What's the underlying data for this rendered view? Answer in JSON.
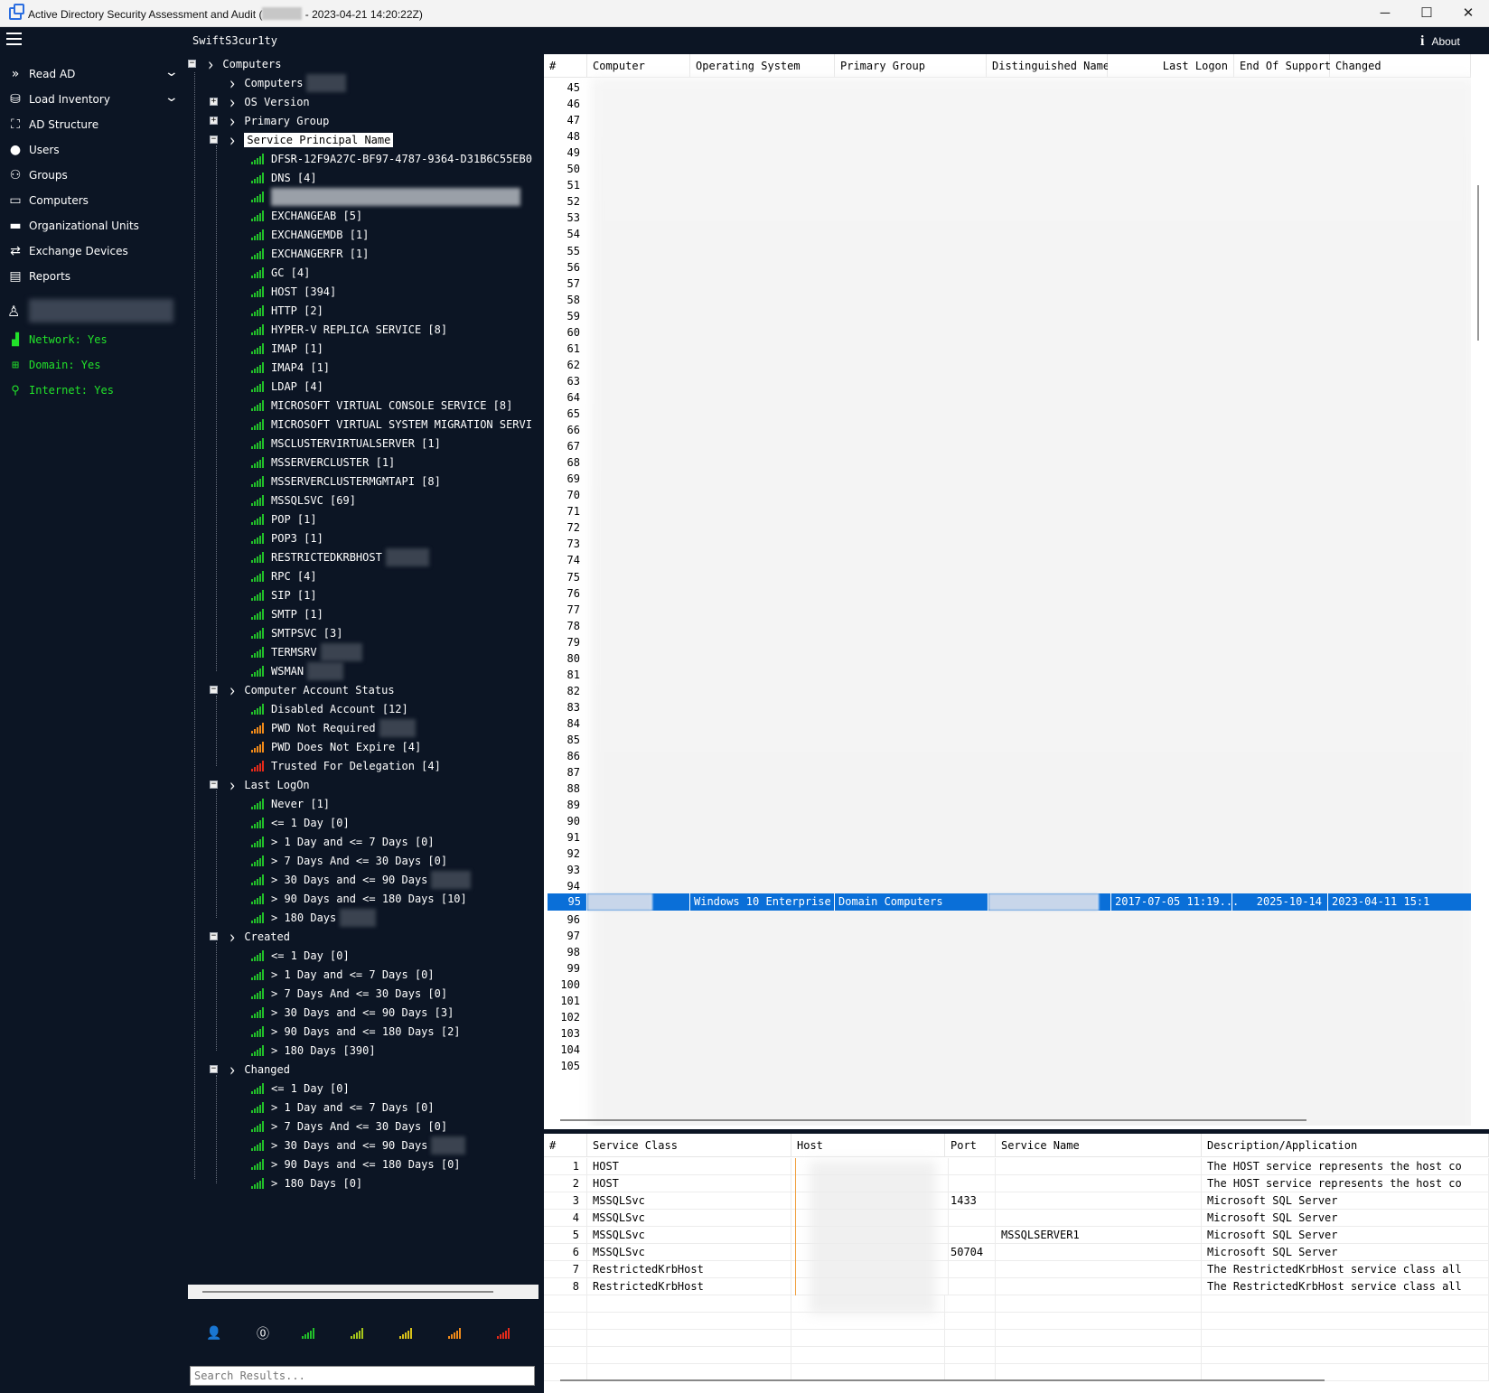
{
  "window": {
    "title_prefix": "Active Directory Security Assessment and Audit (",
    "title_suffix": " - 2023-04-21 14:20:22Z)",
    "minimize": "─",
    "maximize": "☐",
    "close": "✕"
  },
  "topbar": {
    "brand": "SwiftS3cur1ty",
    "about": "About"
  },
  "sidebar": {
    "items": [
      {
        "label": "Read AD",
        "icon": "chevrons-right-icon"
      },
      {
        "label": "Load Inventory",
        "icon": "database-icon"
      },
      {
        "label": "AD Structure",
        "icon": "hierarchy-icon"
      },
      {
        "label": "Users",
        "icon": "user-icon"
      },
      {
        "label": "Groups",
        "icon": "group-icon"
      },
      {
        "label": "Computers",
        "icon": "monitor-icon"
      },
      {
        "label": "Organizational Units",
        "icon": "folder-icon"
      },
      {
        "label": "Exchange Devices",
        "icon": "exchange-icon"
      },
      {
        "label": "Reports",
        "icon": "clipboard-icon"
      }
    ],
    "status": [
      {
        "label": "Network: Yes"
      },
      {
        "label": "Domain: Yes"
      },
      {
        "label": "Internet: Yes"
      }
    ]
  },
  "tree": {
    "root": "Computers",
    "sub_computers": "Computers",
    "os_version": "OS Version",
    "primary_group": "Primary Group",
    "spn": "Service Principal Name",
    "spn_items": [
      "DFSR-12F9A27C-BF97-4787-9364-D31B6C55EB0",
      "DNS [4]",
      "",
      "EXCHANGEAB [5]",
      "EXCHANGEMDB [1]",
      "EXCHANGERFR [1]",
      "GC [4]",
      "HOST [394]",
      "HTTP [2]",
      "HYPER-V REPLICA SERVICE [8]",
      "IMAP [1]",
      "IMAP4 [1]",
      "LDAP [4]",
      "MICROSOFT VIRTUAL CONSOLE SERVICE [8]",
      "MICROSOFT VIRTUAL SYSTEM MIGRATION SERVI",
      "MSCLUSTERVIRTUALSERVER [1]",
      "MSSERVERCLUSTER [1]",
      "MSSERVERCLUSTERMGMTAPI [8]",
      "MSSQLSVC [69]",
      "POP [1]",
      "POP3 [1]",
      "RESTRICTEDKRBHOST",
      "RPC [4]",
      "SIP [1]",
      "SMTP [1]",
      "SMTPSVC [3]",
      "TERMSRV",
      "WSMAN"
    ],
    "account_status": "Computer Account Status",
    "account_items": [
      {
        "label": "Disabled Account [12]",
        "level": "green"
      },
      {
        "label": "PWD Not Required",
        "level": "orange"
      },
      {
        "label": "PWD Does Not Expire [4]",
        "level": "orange"
      },
      {
        "label": "Trusted For Delegation [4]",
        "level": "red"
      }
    ],
    "last_logon": "Last LogOn",
    "last_logon_items": [
      "Never [1]",
      "<= 1 Day [0]",
      "> 1 Day and <= 7 Days [0]",
      "> 7 Days And <= 30 Days [0]",
      "> 30 Days and <= 90 Days",
      "> 90 Days and <= 180 Days [10]",
      "> 180 Days"
    ],
    "created": "Created",
    "created_items": [
      "<= 1 Day [0]",
      "> 1 Day and <= 7 Days [0]",
      "> 7 Days And <= 30 Days [0]",
      "> 30 Days and <= 90 Days [3]",
      "> 90 Days and <= 180 Days [2]",
      "> 180 Days [390]"
    ],
    "changed": "Changed",
    "changed_items": [
      "<= 1 Day [0]",
      "> 1 Day and <= 7 Days [0]",
      "> 7 Days And <= 30 Days [0]",
      "> 30 Days and <= 90 Days",
      "> 90 Days and <= 180 Days [0]",
      "> 180 Days [0]"
    ]
  },
  "search": {
    "placeholder": "Search Results..."
  },
  "main_grid": {
    "columns": [
      "#",
      "Computer",
      "Operating System",
      "Primary Group",
      "Distinguished Name",
      "Last Logon",
      "End Of Support",
      "Changed"
    ],
    "row_start": 45,
    "row_end": 105,
    "selected_row": {
      "num": "95",
      "os": "Windows 10 Enterprise",
      "group": "Domain Computers",
      "last_logon": "2017-07-05 11:19...",
      "end_of_support": "2025-10-14",
      "changed": "2023-04-11 15:1"
    }
  },
  "bottom_grid": {
    "columns": [
      "#",
      "Service Class",
      "Host",
      "Port",
      "Service Name",
      "Description/Application"
    ],
    "rows": [
      {
        "num": "1",
        "class": "HOST",
        "port": "",
        "name": "",
        "desc": "The HOST service represents the host co"
      },
      {
        "num": "2",
        "class": "HOST",
        "port": "",
        "name": "",
        "desc": "The HOST service represents the host co"
      },
      {
        "num": "3",
        "class": "MSSQLSvc",
        "port": "1433",
        "name": "",
        "desc": "Microsoft SQL Server"
      },
      {
        "num": "4",
        "class": "MSSQLSvc",
        "port": "",
        "name": "",
        "desc": "Microsoft SQL Server"
      },
      {
        "num": "5",
        "class": "MSSQLSvc",
        "port": "",
        "name": "MSSQLSERVER1",
        "desc": "Microsoft SQL Server"
      },
      {
        "num": "6",
        "class": "MSSQLSvc",
        "port": "50704",
        "name": "",
        "desc": "Microsoft SQL Server"
      },
      {
        "num": "7",
        "class": "RestrictedKrbHost",
        "port": "",
        "name": "",
        "desc": "The RestrictedKrbHost service class all"
      },
      {
        "num": "8",
        "class": "RestrictedKrbHost",
        "port": "",
        "name": "",
        "desc": "The RestrictedKrbHost service class all"
      }
    ]
  }
}
